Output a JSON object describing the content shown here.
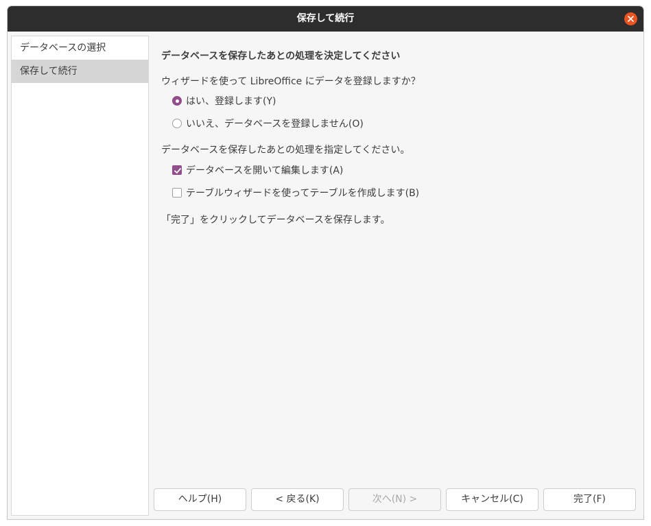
{
  "window": {
    "title": "保存して続行"
  },
  "sidebar": {
    "items": [
      {
        "label": "データベースの選択"
      },
      {
        "label": "保存して続行"
      }
    ]
  },
  "main": {
    "heading": "データベースを保存したあとの処理を決定してください",
    "register_question": "ウィザードを使って LibreOffice にデータを登録しますか？",
    "register_yes": "はい、登録します(Y)",
    "register_no": "いいえ、データベースを登録しません(O)",
    "register_selected": "yes",
    "after_save_prompt": "データベースを保存したあとの処理を指定してください。",
    "open_for_editing": "データベースを開いて編集します(A)",
    "open_for_editing_checked": true,
    "create_tables": "テーブルウィザードを使ってテーブルを作成します(B)",
    "create_tables_checked": false,
    "finish_hint": "「完了」をクリックしてデータベースを保存します。"
  },
  "buttons": {
    "help": "ヘルプ(H)",
    "back": "< 戻る(K)",
    "next": "次へ(N) >",
    "cancel": "キャンセル(C)",
    "finish": "完了(F)"
  },
  "colors": {
    "titlebar": "#2d2d2d",
    "close": "#e95420",
    "accent": "#924d8b"
  },
  "icons": {
    "close": "close-icon",
    "check": "checkmark-icon"
  }
}
